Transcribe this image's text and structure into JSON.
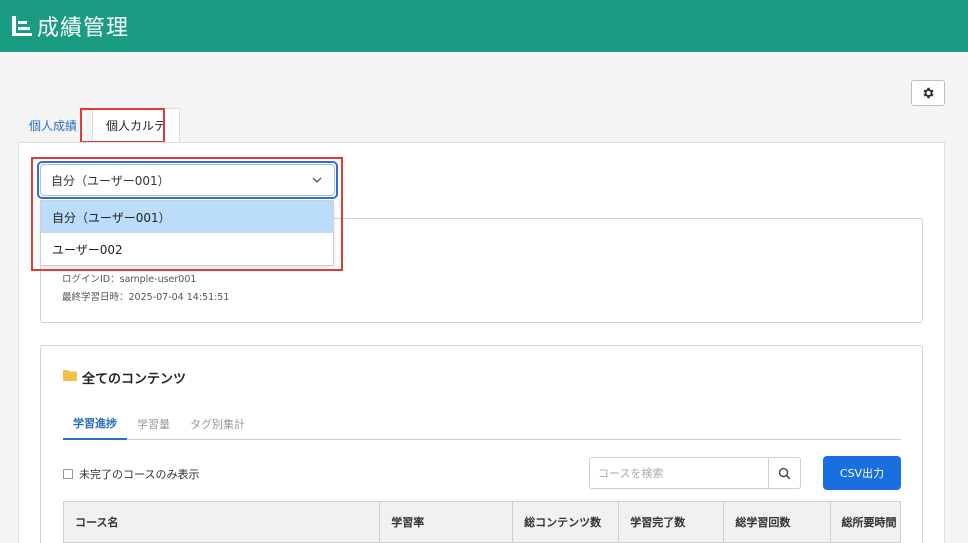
{
  "app": {
    "title": "成績管理"
  },
  "tabs": [
    {
      "label": "個人成績"
    },
    {
      "label": "個人カルテ"
    }
  ],
  "user_select": {
    "value": "自分（ユーザー001）",
    "options": [
      "自分（ユーザー001）",
      "ユーザー002"
    ]
  },
  "user_info": {
    "login_id": "ログインID：sample-user001",
    "last_study": "最終学習日時：2025-07-04 14:51:51"
  },
  "content": {
    "title": "全てのコンテンツ",
    "subtabs": [
      "学習進捗",
      "学習量",
      "タグ別集計"
    ],
    "filter_label": "未完了のコースのみ表示",
    "search_placeholder": "コースを検索",
    "csv_label": "CSV出力",
    "columns": [
      "コース名",
      "学習率",
      "総コンテンツ数",
      "学習完了数",
      "総学習回数",
      "総所要時間"
    ]
  },
  "icons": {
    "logo": "chart-logo-icon",
    "settings": "gear-icon",
    "folder": "folder-icon",
    "search": "search-icon",
    "chevron": "chevron-down-icon"
  },
  "colors": {
    "header": "#1a9c83",
    "accent": "#1a6fe0",
    "highlight": "#e03a3a",
    "selected_option": "#bcdcfb"
  }
}
